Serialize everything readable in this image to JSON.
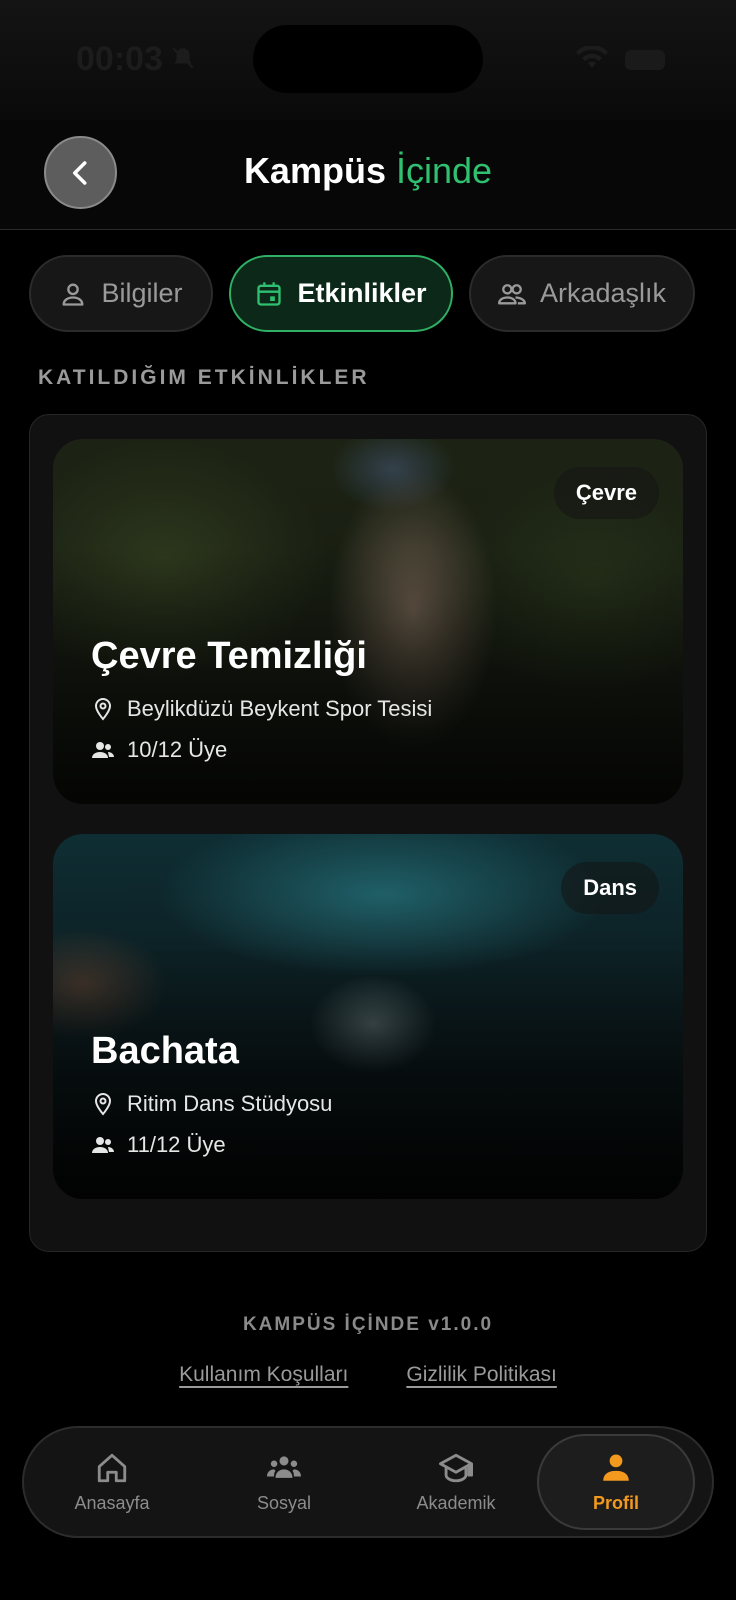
{
  "status_bar": {
    "time": "00:03"
  },
  "header": {
    "title_main": "Kampüs",
    "title_accent": "İçinde"
  },
  "tabs": [
    {
      "label": "Bilgiler",
      "icon": "person-icon",
      "active": false
    },
    {
      "label": "Etkinlikler",
      "icon": "calendar-icon",
      "active": true
    },
    {
      "label": "Arkadaşlık",
      "icon": "people-icon",
      "active": false
    }
  ],
  "section_title": "KATILDIĞIM ETKİNLİKLER",
  "events": [
    {
      "title": "Çevre Temizliği",
      "category": "Çevre",
      "location": "Beylikdüzü Beykent Spor Tesisi",
      "members": "10/12 Üye"
    },
    {
      "title": "Bachata",
      "category": "Dans",
      "location": "Ritim Dans Stüdyosu",
      "members": "11/12 Üye"
    }
  ],
  "footer": {
    "version": "KAMPÜS İÇİNDE v1.0.0",
    "links": [
      "Kullanım Koşulları",
      "Gizlilik Politikası"
    ]
  },
  "bottom_nav": [
    {
      "label": "Anasayfa",
      "icon": "home-icon",
      "active": false
    },
    {
      "label": "Sosyal",
      "icon": "group-icon",
      "active": false
    },
    {
      "label": "Akademik",
      "icon": "graduation-cap-icon",
      "active": false
    },
    {
      "label": "Profil",
      "icon": "profile-icon",
      "active": true
    }
  ],
  "colors": {
    "accent_green": "#2fc070",
    "accent_orange": "#f39a1e",
    "background": "#000000"
  }
}
